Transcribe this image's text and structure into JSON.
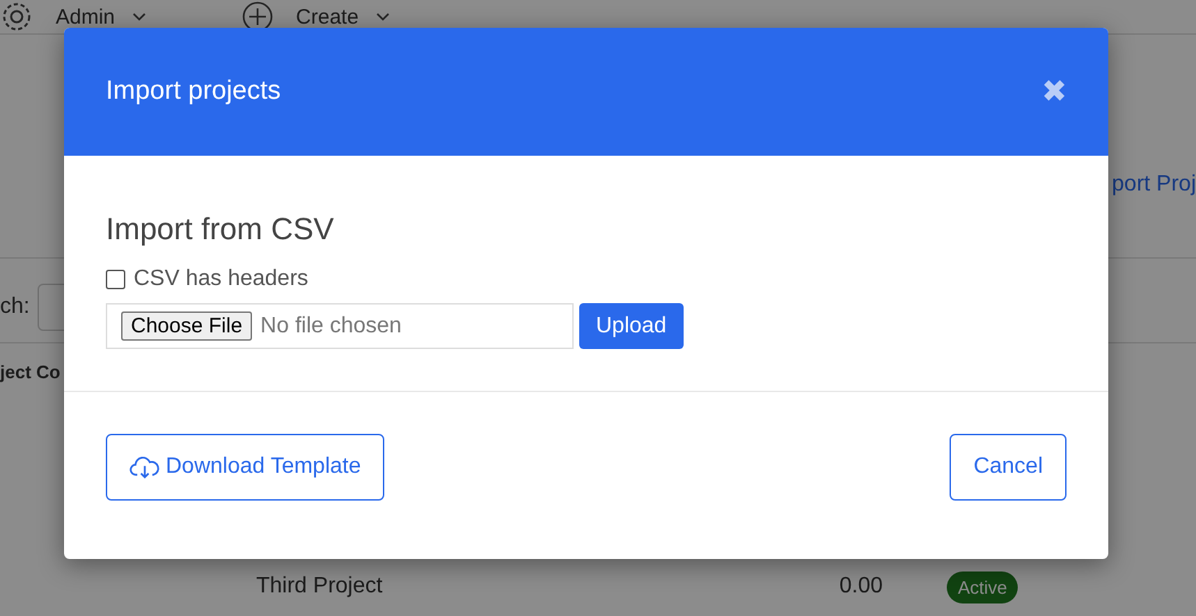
{
  "page": {
    "topbar": {
      "user_menu": "Admin",
      "create_menu": "Create"
    },
    "import_link": "port Proj",
    "search_label": "ch:",
    "column_header": "ject Co",
    "rows": [
      {
        "name": "Third Project",
        "amount": "0.00",
        "status": "Active"
      }
    ]
  },
  "dialog": {
    "title": "Import projects",
    "close": "✖",
    "section_title": "Import from CSV",
    "headers_checkbox": {
      "label": "CSV has headers",
      "checked": false
    },
    "file_input": {
      "button": "Choose File",
      "status": "No file chosen"
    },
    "upload_button": "Upload",
    "download_button": "Download Template",
    "cancel_button": "Cancel"
  }
}
